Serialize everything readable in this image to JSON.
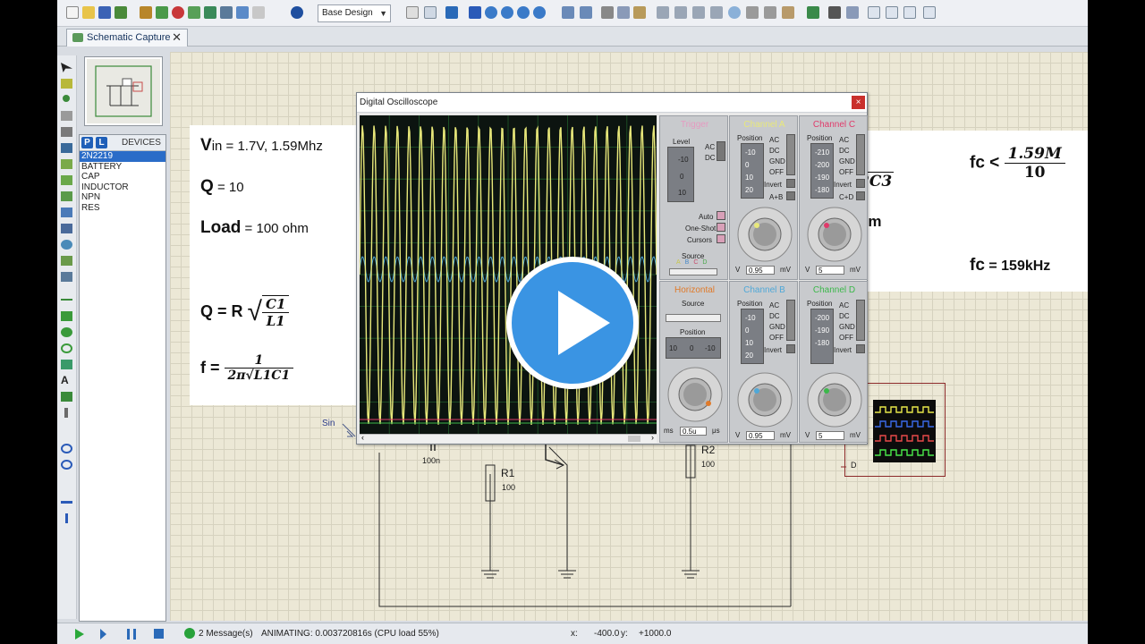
{
  "toolbar": {
    "design_select": "Base Design"
  },
  "tab": {
    "label": "Schematic Capture"
  },
  "devices": {
    "p_label": "P",
    "l_label": "L",
    "header": "DEVICES",
    "items": [
      {
        "label": "2N2219",
        "selected": true
      },
      {
        "label": "BATTERY",
        "selected": false
      },
      {
        "label": "CAP",
        "selected": false
      },
      {
        "label": "INDUCTOR",
        "selected": false
      },
      {
        "label": "NPN",
        "selected": false
      },
      {
        "label": "RES",
        "selected": false
      }
    ]
  },
  "equations_left": {
    "vin_sym": "V",
    "vin_sub": "in",
    "vin_val": " = 1.7V, 1.59Mhz",
    "q_sym": "Q",
    "q_val": " = 10",
    "load_sym": "Load",
    "load_val": " = 100 ohm",
    "q_formula_lhs": "Q = R",
    "q_num": "C1",
    "q_den": "L1",
    "f_lhs": "f =",
    "f_num": "1",
    "f_den": "2π√L1C1"
  },
  "equations_right": {
    "frag_c3": "2C3",
    "frag_ohm": "hm",
    "fc_lhs": "fc <",
    "fc_num": "1.59M",
    "fc_den": "10",
    "fc2_sym": "fc",
    "fc2_val": " = 159kHz"
  },
  "oscilloscope": {
    "title": "Digital Oscilloscope",
    "close": "×",
    "trigger": {
      "header": "Trigger",
      "level_label": "Level",
      "level_ticks": [
        "-10",
        "0",
        "10"
      ],
      "coupling": [
        "AC",
        "DC"
      ],
      "modes": [
        "Auto",
        "One-Shot",
        "Cursors"
      ],
      "source_label": "Source",
      "source_letters": [
        "A",
        "B",
        "C",
        "D"
      ]
    },
    "channel_a": {
      "header": "Channel A",
      "position_label": "Position",
      "ticks": [
        "-10",
        "0",
        "10",
        "20"
      ],
      "modes": [
        "AC",
        "DC",
        "GND",
        "OFF"
      ],
      "invert": "Invert",
      "combine": "A+B",
      "units": [
        "V",
        "mV"
      ],
      "value": "0.95"
    },
    "channel_c": {
      "header": "Channel C",
      "position_label": "Position",
      "ticks": [
        "-210",
        "-200",
        "-190",
        "-180"
      ],
      "modes": [
        "AC",
        "DC",
        "GND",
        "OFF"
      ],
      "invert": "Invert",
      "combine": "C+D",
      "units": [
        "V",
        "mV"
      ],
      "value": "5"
    },
    "horizontal": {
      "header": "Horizontal",
      "source_label": "Source",
      "position_label": "Position",
      "ticks": [
        "10",
        "0",
        "-10"
      ],
      "units": [
        "ms",
        "μs"
      ],
      "value": "0.5u"
    },
    "channel_b": {
      "header": "Channel B",
      "position_label": "Position",
      "ticks": [
        "-10",
        "0",
        "10",
        "20"
      ],
      "modes": [
        "AC",
        "DC",
        "GND",
        "OFF"
      ],
      "invert": "Invert",
      "units": [
        "V",
        "mV"
      ],
      "value": "0.95"
    },
    "channel_d": {
      "header": "Channel D",
      "position_label": "Position",
      "ticks": [
        "-200",
        "-190",
        "-180"
      ],
      "modes": [
        "AC",
        "DC",
        "GND",
        "OFF"
      ],
      "invert": "Invert",
      "units": [
        "V",
        "mV"
      ],
      "value": "5"
    },
    "colors": {
      "channel_a": "#e8e87a",
      "channel_b": "#4fa8d8",
      "channel_c": "#e03a6a",
      "channel_d": "#3bb84a",
      "trigger": "#e06aa0",
      "horizontal": "#e07a2a"
    }
  },
  "schematic": {
    "sin_label": "Sin",
    "cap_value": "100n",
    "r1_label": "R1",
    "r1_value": "100",
    "r2_label": "R2",
    "r2_value": "100",
    "gen_pin": "D"
  },
  "status": {
    "messages": "2 Message(s)",
    "animating": "ANIMATING: 0.003720816s (CPU load 55%)",
    "x_label": "x:",
    "x_value": "-400.0",
    "y_label": "y:",
    "y_value": "+1000.0"
  }
}
